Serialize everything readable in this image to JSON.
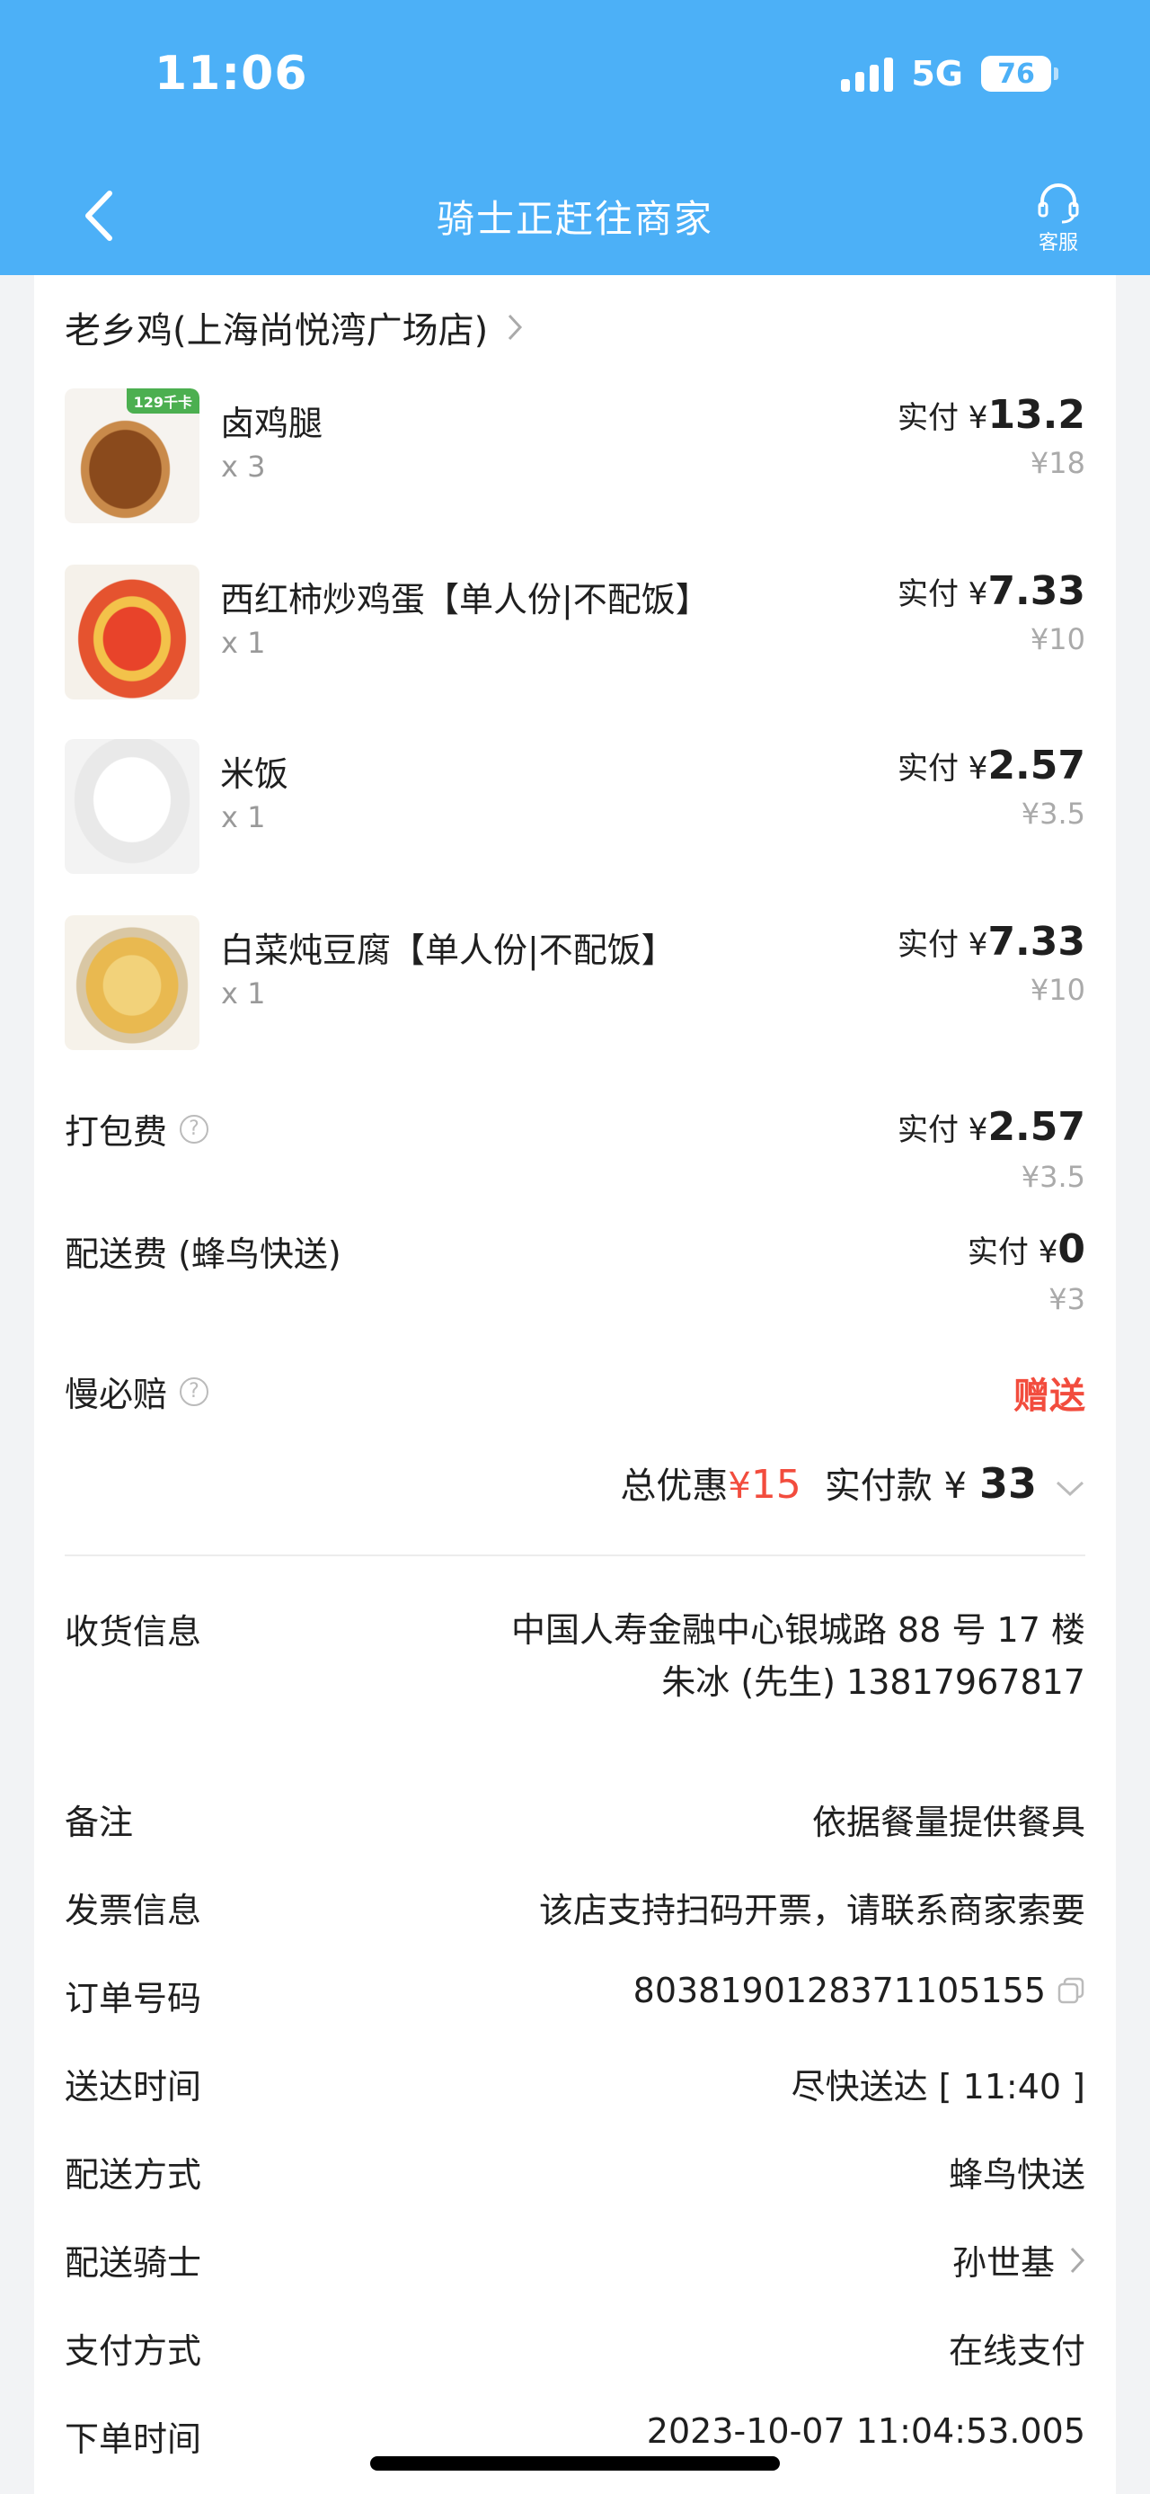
{
  "status_bar": {
    "time": "11:06",
    "network": "5G",
    "battery": "76"
  },
  "nav": {
    "title": "骑士正赶往商家",
    "service_label": "客服"
  },
  "shop": {
    "name": "老乡鸡(上海尚悦湾广场店)"
  },
  "items": [
    {
      "name": "卤鸡腿",
      "qty": "x 3",
      "paid_label": "实付 ¥",
      "paid": "13.2",
      "original": "¥18",
      "tag": "129千卡"
    },
    {
      "name": "西红柿炒鸡蛋【单人份|不配饭】",
      "qty": "x 1",
      "paid_label": "实付 ¥",
      "paid": "7.33",
      "original": "¥10"
    },
    {
      "name": "米饭",
      "qty": "x 1",
      "paid_label": "实付 ¥",
      "paid": "2.57",
      "original": "¥3.5"
    },
    {
      "name": "白菜炖豆腐【单人份|不配饭】",
      "qty": "x 1",
      "paid_label": "实付 ¥",
      "paid": "7.33",
      "original": "¥10"
    }
  ],
  "fees": {
    "packing": {
      "label": "打包费",
      "paid_label": "实付 ¥",
      "paid": "2.57",
      "original": "¥3.5"
    },
    "delivery": {
      "label": "配送费 (蜂鸟快送)",
      "paid_label": "实付 ¥",
      "paid": "0",
      "original": "¥3"
    },
    "late_compensation": {
      "label": "慢必赔",
      "value": "赠送"
    }
  },
  "summary": {
    "discount_label": "总优惠",
    "discount_currency": "¥",
    "discount": "15",
    "paid_label": "实付款 ¥",
    "paid": "33"
  },
  "info": {
    "receiver": {
      "label": "收货信息",
      "address": "中国人寿金融中心银城路 88 号 17 楼",
      "contact": "朱冰 (先生) 13817967817"
    },
    "remark": {
      "label": "备注",
      "value": "依据餐量提供餐具"
    },
    "invoice": {
      "label": "发票信息",
      "value": "该店支持扫码开票，请联系商家索要"
    },
    "order_no": {
      "label": "订单号码",
      "value": "8038190128371105155"
    },
    "delivery_time": {
      "label": "送达时间",
      "value": "尽快送达 [ 11:40 ]"
    },
    "delivery_method": {
      "label": "配送方式",
      "value": "蜂鸟快送"
    },
    "rider": {
      "label": "配送骑士",
      "value": "孙世基"
    },
    "payment": {
      "label": "支付方式",
      "value": "在线支付"
    },
    "order_time": {
      "label": "下单时间",
      "value": "2023-10-07 11:04:53.005"
    }
  },
  "colors": {
    "header": "#4cb0f7",
    "accent_red": "#f24c3d"
  }
}
